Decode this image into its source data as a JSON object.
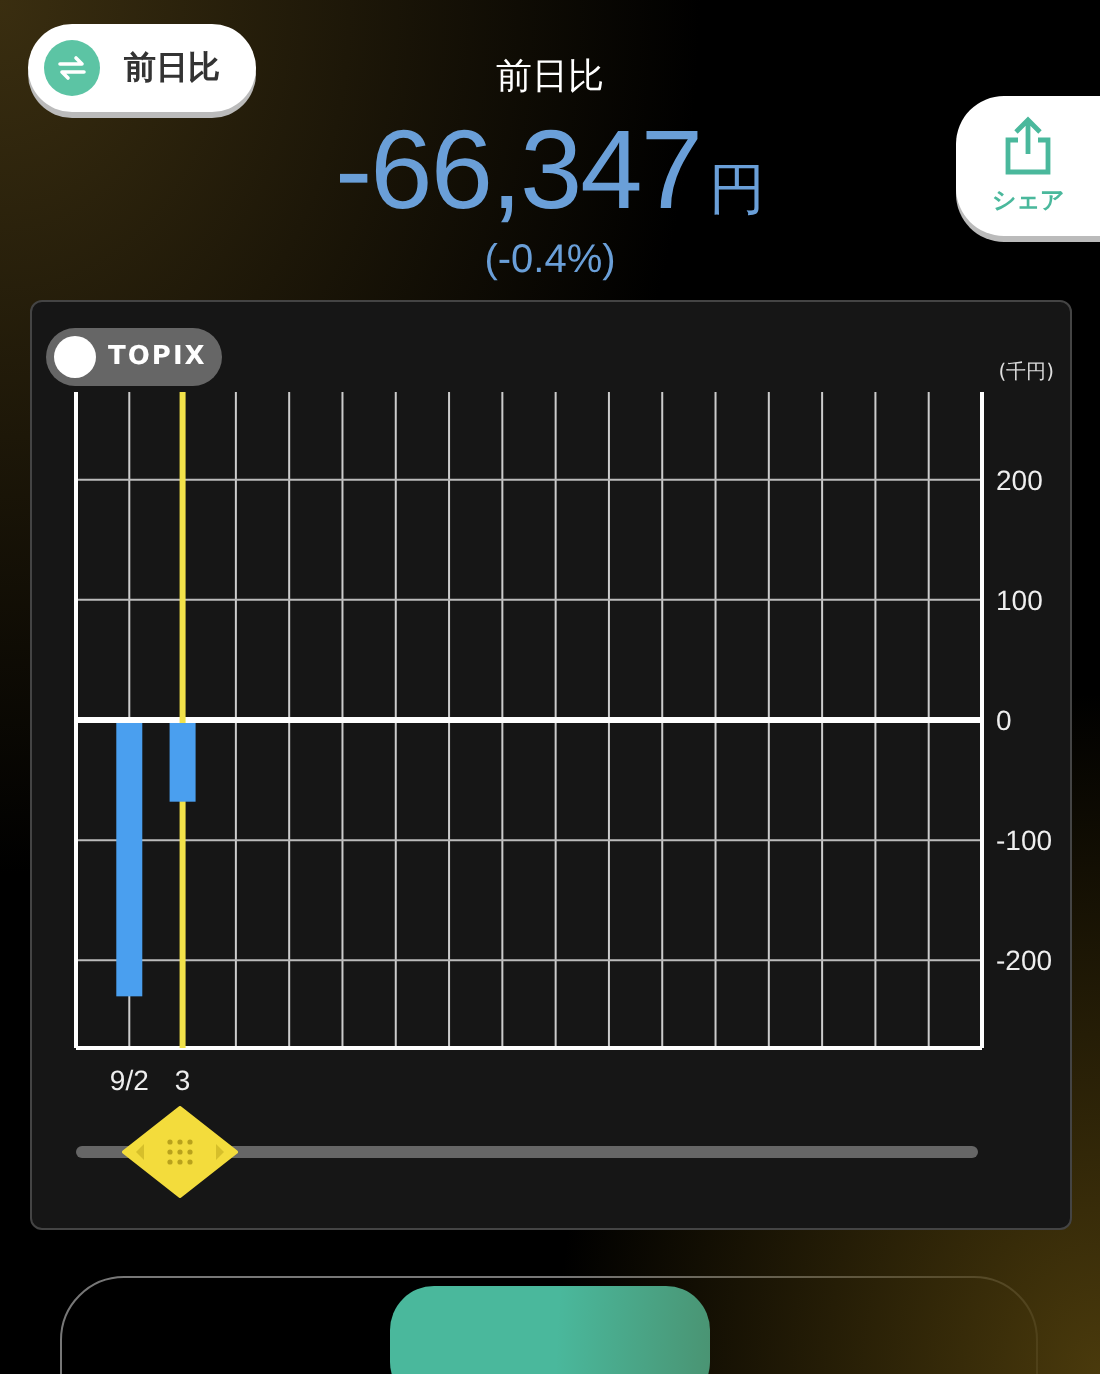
{
  "compare_button": {
    "label": "前日比"
  },
  "title": "前日比",
  "amount": {
    "value": "-66,347",
    "unit": "円"
  },
  "percent": "(-0.4%)",
  "share_button": {
    "label": "シェア"
  },
  "chart": {
    "toggle": {
      "label": "TOPIX",
      "on": false
    },
    "chart_data": {
      "type": "bar",
      "ylabel": "(千円)",
      "categories": [
        null,
        "9/2",
        "3",
        null,
        null,
        null,
        null,
        null,
        null,
        null,
        null,
        null,
        null,
        null,
        null,
        null,
        null,
        null
      ],
      "series": [
        {
          "color": "#4a9fef",
          "values": [
            null,
            -230,
            -68,
            null,
            null,
            null,
            null,
            null,
            null,
            null,
            null,
            null,
            null,
            null,
            null,
            null,
            null,
            null
          ]
        }
      ],
      "ylim": [
        -273,
        273
      ],
      "yticks": [
        -200,
        -100,
        0,
        100,
        200
      ],
      "grid": true,
      "ref_lines": [
        {
          "axis": "x",
          "value": "3",
          "color": "#f2e24a"
        }
      ]
    },
    "slider": {
      "level": 0.115
    }
  }
}
